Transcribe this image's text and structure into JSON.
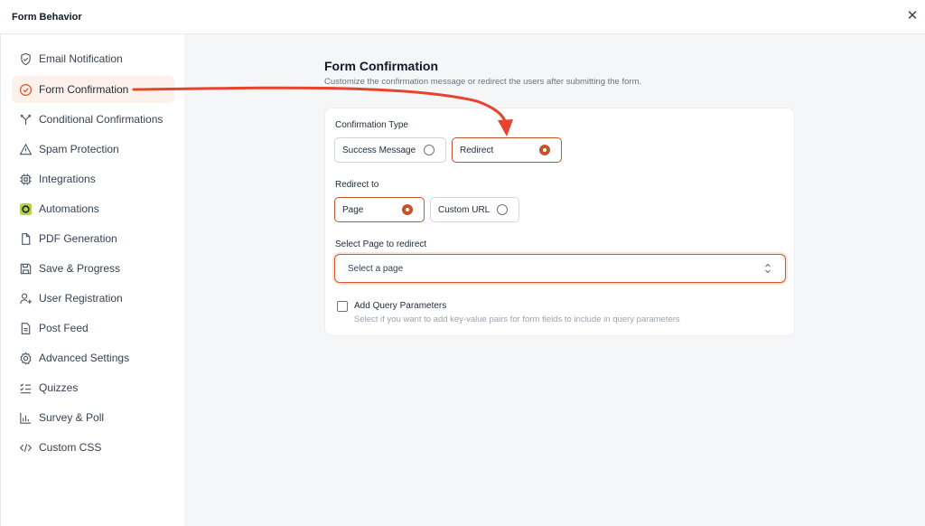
{
  "header": {
    "title": "Form Behavior",
    "close_glyph": "✕"
  },
  "sidebar": {
    "items": [
      {
        "label": "Email Notification",
        "icon": "shield-check-icon"
      },
      {
        "label": "Form Confirmation",
        "icon": "check-circle-icon",
        "active": true
      },
      {
        "label": "Conditional Confirmations",
        "icon": "branch-icon"
      },
      {
        "label": "Spam Protection",
        "icon": "warning-triangle-icon"
      },
      {
        "label": "Integrations",
        "icon": "chip-icon"
      },
      {
        "label": "Automations",
        "icon": "automation-icon"
      },
      {
        "label": "PDF Generation",
        "icon": "file-icon"
      },
      {
        "label": "Save & Progress",
        "icon": "floppy-icon"
      },
      {
        "label": "User Registration",
        "icon": "user-plus-icon"
      },
      {
        "label": "Post Feed",
        "icon": "document-icon"
      },
      {
        "label": "Advanced Settings",
        "icon": "gear-icon"
      },
      {
        "label": "Quizzes",
        "icon": "checklist-icon"
      },
      {
        "label": "Survey & Poll",
        "icon": "bar-chart-icon"
      },
      {
        "label": "Custom CSS",
        "icon": "code-icon"
      }
    ]
  },
  "main": {
    "title": "Form Confirmation",
    "subtitle": "Customize the confirmation message or redirect the users after submitting the form.",
    "confirmation_type": {
      "label": "Confirmation Type",
      "options": [
        {
          "label": "Success Message",
          "selected": false
        },
        {
          "label": "Redirect",
          "selected": true
        }
      ]
    },
    "redirect_to": {
      "label": "Redirect to",
      "options": [
        {
          "label": "Page",
          "selected": true
        },
        {
          "label": "Custom URL",
          "selected": false
        }
      ]
    },
    "select_page": {
      "label": "Select Page to redirect",
      "placeholder": "Select a page"
    },
    "query_params": {
      "label": "Add Query Parameters",
      "help": "Select if you want to add key-value pairs for form fields to include in query parameters",
      "checked": false
    }
  },
  "colors": {
    "accent": "#c2542a",
    "annotation_arrow": "#e8432e",
    "active_bg": "#fdf1eb",
    "automation_icon_bg": "#b5d33d"
  }
}
